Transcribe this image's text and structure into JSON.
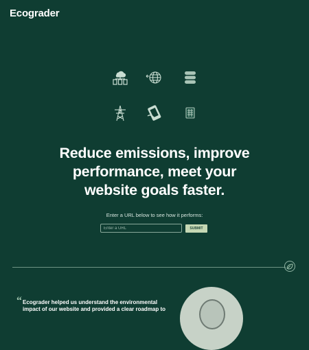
{
  "header": {
    "logo_text": "Ecograder"
  },
  "hero": {
    "icons": [
      "cloud-server-icon",
      "globe-network-icon",
      "database-icon",
      "power-tower-icon",
      "mobile-payment-icon",
      "device-icon"
    ],
    "headline": "Reduce emissions, improve performance, meet your website goals faster.",
    "prompt": "Enter a URL below to see how it performs:",
    "url_placeholder": "Enter a URL",
    "submit_label": "SUBMIT"
  },
  "testimonial": {
    "quote_mark": "“",
    "quote": "Ecograder helped us understand the environmental impact of our website and provided a clear roadmap to"
  },
  "colors": {
    "background": "#0f3d32",
    "accent": "#c5d8b4",
    "text": "#ffffff"
  }
}
